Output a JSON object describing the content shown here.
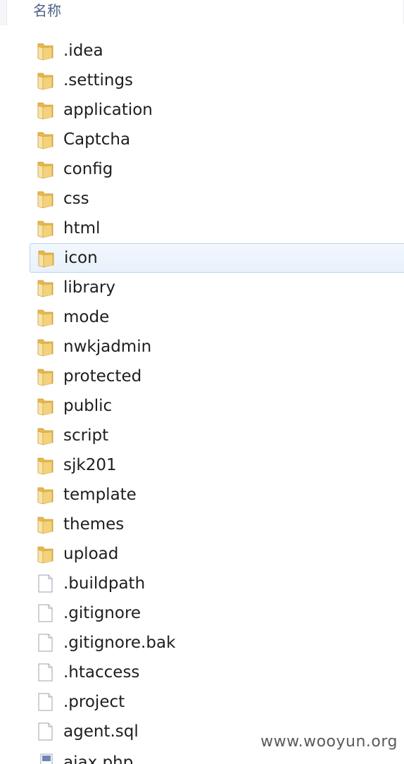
{
  "header": {
    "name_column_label": "名称"
  },
  "folders": [
    {
      "name": ".idea"
    },
    {
      "name": ".settings"
    },
    {
      "name": "application"
    },
    {
      "name": "Captcha"
    },
    {
      "name": "config"
    },
    {
      "name": "css"
    },
    {
      "name": "html"
    },
    {
      "name": "icon",
      "selected": true
    },
    {
      "name": "library"
    },
    {
      "name": "mode"
    },
    {
      "name": "nwkjadmin"
    },
    {
      "name": "protected"
    },
    {
      "name": "public"
    },
    {
      "name": "script"
    },
    {
      "name": "sjk201"
    },
    {
      "name": "template"
    },
    {
      "name": "themes"
    },
    {
      "name": "upload"
    }
  ],
  "files": [
    {
      "name": ".buildpath"
    },
    {
      "name": ".gitignore"
    },
    {
      "name": ".gitignore.bak"
    },
    {
      "name": ".htaccess"
    },
    {
      "name": ".project"
    },
    {
      "name": "agent.sql"
    }
  ],
  "partial_file": {
    "name": "ajax.php"
  },
  "watermark": "www.wooyun.org",
  "colors": {
    "folder_front": "#f3d27a",
    "folder_back": "#e8b84a",
    "selection_border": "#b9d3ef",
    "selection_fill": "#e8f1fb",
    "header_text": "#4d6185"
  }
}
